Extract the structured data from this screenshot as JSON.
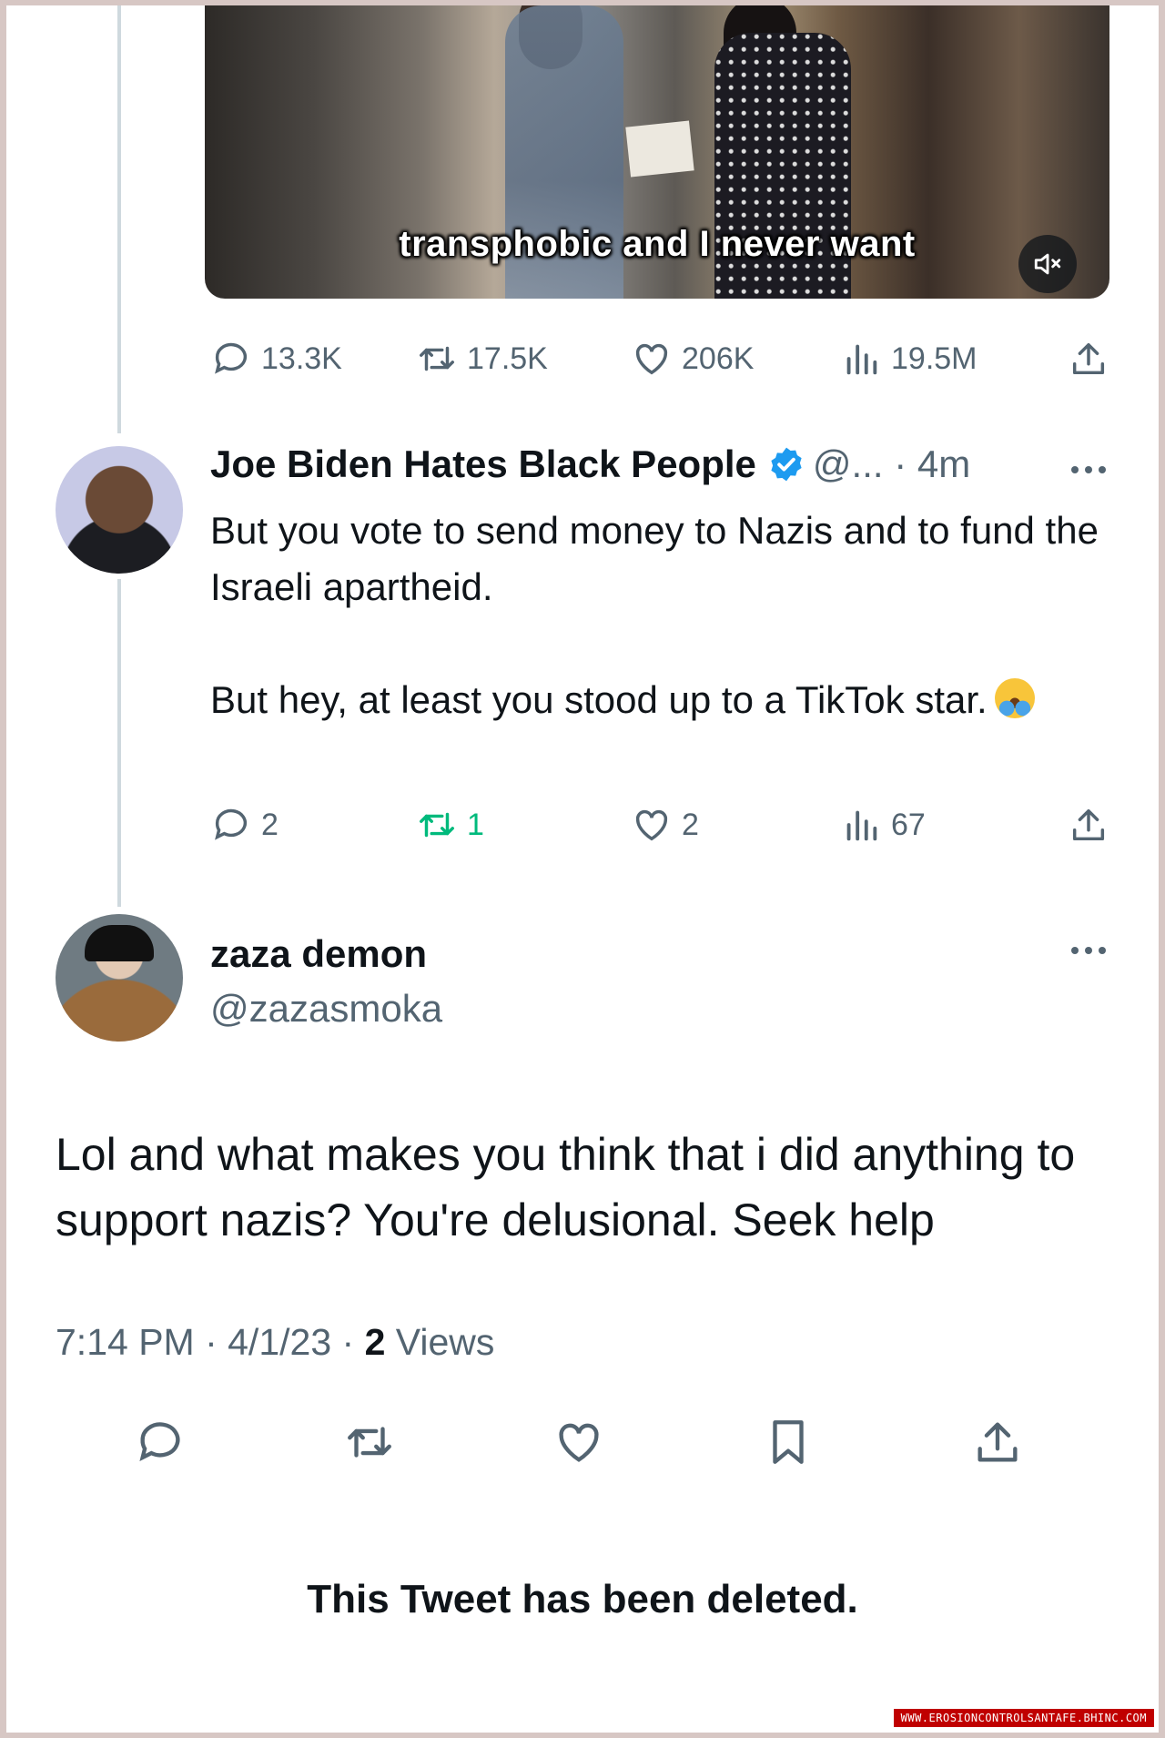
{
  "video": {
    "caption": "transphobic and I never want",
    "mute_icon": "speaker-muted-icon"
  },
  "original_stats": {
    "replies": "13.3K",
    "retweets": "17.5K",
    "likes": "206K",
    "views": "19.5M"
  },
  "reply": {
    "display_name": "Joe Biden Hates Black People",
    "verified": true,
    "handle_time": "@... · 4m",
    "text_p1": "But you vote to send money to Nazis and to fund the Israeli apartheid.",
    "text_p2": "But hey, at least you stood up to a TikTok star.",
    "emoji": "face-with-tears-of-joy",
    "stats": {
      "replies": "2",
      "retweets": "1",
      "likes": "2",
      "views": "67"
    }
  },
  "main_tweet": {
    "display_name": "zaza demon",
    "handle": "@zazasmoka",
    "text": "Lol and what makes you think that i did anything to support nazis? You're delusional. Seek help",
    "time_date": "7:14 PM · 4/1/23 · ",
    "views_count": "2",
    "views_label": " Views"
  },
  "deleted_notice": "This Tweet has been deleted.",
  "watermark": "WWW.EROSIONCONTROLSANTAFE.BHINC.COM",
  "colors": {
    "text": "#0f1419",
    "secondary": "#536471",
    "retweet_active": "#00ba7c",
    "verified": "#1d9bf0",
    "thread_line": "#cfd9de"
  }
}
